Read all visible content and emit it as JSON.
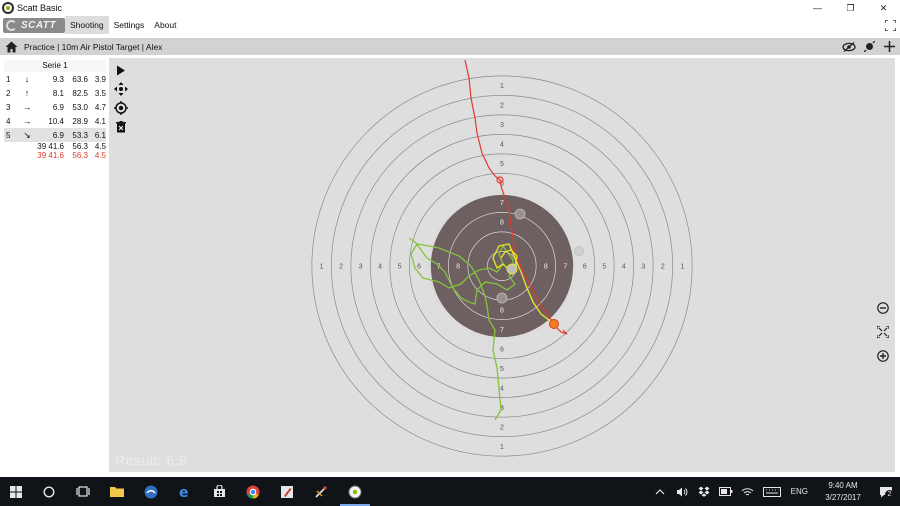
{
  "window": {
    "title": "Scatt Basic",
    "controls": {
      "minimize": "—",
      "maximize": "❐",
      "close": "✕"
    }
  },
  "menu": {
    "logo_text": "SCATT",
    "items": [
      {
        "label": "Shooting",
        "active": true
      },
      {
        "label": "Settings",
        "active": false
      },
      {
        "label": "About",
        "active": false
      }
    ]
  },
  "breadcrumb": {
    "text": "Practice | 10m Air Pistol Target | Alex"
  },
  "series": {
    "header": "Serie 1",
    "shots": [
      {
        "num": "1",
        "dir": "↓",
        "score": "9.3",
        "time": "63.6",
        "dist": "3.9"
      },
      {
        "num": "2",
        "dir": "↑",
        "score": "8.1",
        "time": "82.5",
        "dist": "3.5"
      },
      {
        "num": "3",
        "dir": "→",
        "score": "6.9",
        "time": "53.0",
        "dist": "4.7"
      },
      {
        "num": "4",
        "dir": "→",
        "score": "10.4",
        "time": "28.9",
        "dist": "4.1"
      },
      {
        "num": "5",
        "dir": "↘",
        "score": "6.9",
        "time": "53.3",
        "dist": "6.1"
      }
    ],
    "summary": {
      "score": "39 41.6",
      "time": "56.3",
      "dist": "4.5"
    },
    "summary_red": {
      "score": "39 41.6",
      "time": "56.3",
      "dist": "4.5"
    }
  },
  "target": {
    "ring_labels": [
      "1",
      "2",
      "3",
      "4",
      "5",
      "6",
      "7",
      "8"
    ],
    "result_text": "Result: 6.9",
    "colors": {
      "background": "#dedede",
      "black_zone": "#6e6060",
      "trace_red": "#e03a2c",
      "trace_green": "#86c23a",
      "trace_yellow": "#e2e22a"
    }
  },
  "taskbar": {
    "clock_time": "9:40 AM",
    "clock_date": "3/27/2017",
    "language": "ENG",
    "notification_count": "2"
  }
}
